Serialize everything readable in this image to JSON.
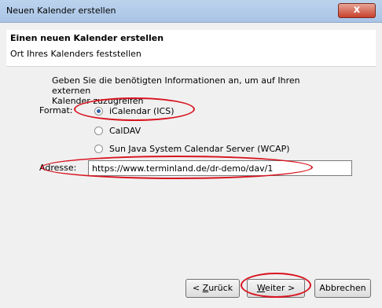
{
  "window": {
    "title": "Neuen Kalender erstellen",
    "close_symbol": "x"
  },
  "header": {
    "title": "Einen neuen Kalender erstellen",
    "subtitle": "Ort Ihres Kalenders feststellen"
  },
  "form": {
    "intro_line1": "Geben Sie die benötigten Informationen an, um auf Ihren externen",
    "intro_line2": "Kalender zuzugreifen",
    "format_label": "Format:",
    "options": [
      {
        "label": "iCalendar (ICS)",
        "checked": true
      },
      {
        "label": "CalDAV",
        "checked": false
      },
      {
        "label": "Sun Java System Calendar Server (WCAP)",
        "checked": false
      }
    ],
    "address_label": "Adresse:",
    "address_value": "https://www.terminland.de/dr-demo/dav/1"
  },
  "buttons": {
    "back_prefix": "< ",
    "back_key": "Z",
    "back_rest": "urück",
    "next_key": "W",
    "next_rest": "eiter >",
    "cancel": "Abbrechen"
  },
  "annotation_color": "#d8141f"
}
